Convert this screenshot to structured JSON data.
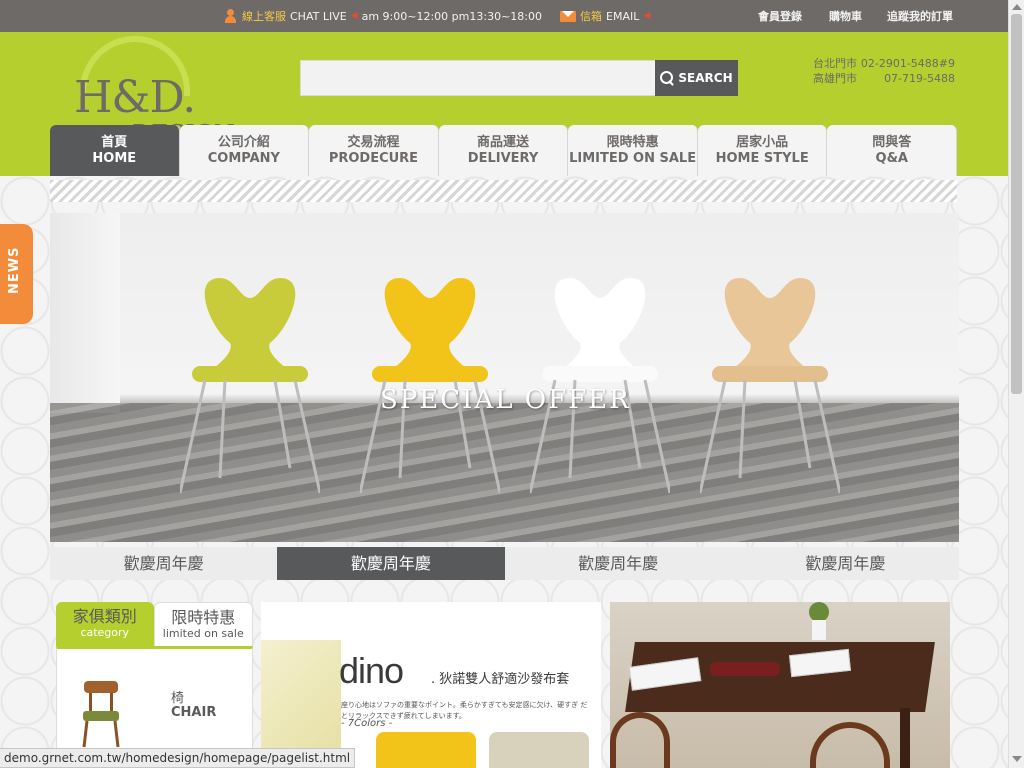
{
  "topbar": {
    "service_label": "線上客服",
    "chat_live": "CHAT LIVE",
    "hours": "am 9:00~12:00 pm13:30~18:00",
    "mail_label": "信箱",
    "mail_en": "EMAIL",
    "links": [
      "會員登錄",
      "購物車",
      "追蹤我的訂單"
    ]
  },
  "logo": {
    "main": "H&D.",
    "sub": "DESIGN"
  },
  "search": {
    "placeholder": "",
    "button_label": "SEARCH"
  },
  "stores": [
    {
      "city": "台北門市",
      "phone": "02-2901-5488#9"
    },
    {
      "city": "高雄門市",
      "phone": "07-719-5488"
    }
  ],
  "nav": [
    {
      "zh": "首頁",
      "en": "HOME",
      "active": true
    },
    {
      "zh": "公司介紹",
      "en": "COMPANY"
    },
    {
      "zh": "交易流程",
      "en": "PRODECURE"
    },
    {
      "zh": "商品運送",
      "en": "DELIVERY"
    },
    {
      "zh": "限時特惠",
      "en": "LIMITED ON SALE"
    },
    {
      "zh": "居家小品",
      "en": "HOME STYLE"
    },
    {
      "zh": "問與答",
      "en": "Q&A"
    }
  ],
  "news_tag": "NEWS",
  "banner": {
    "caption": "SPECIAL OFFER",
    "chair_colors": [
      "#c9cc3a",
      "#f2c318",
      "#ffffff",
      "#e8c697"
    ],
    "tabs": [
      "歡慶周年慶",
      "歡慶周年慶",
      "歡慶周年慶",
      "歡慶周年慶"
    ],
    "active_tab": 1
  },
  "category": {
    "tabs": [
      {
        "zh": "家俱類別",
        "en": "category",
        "active": true
      },
      {
        "zh": "限時特惠",
        "en": "limited on sale"
      }
    ],
    "items": [
      {
        "zh": "椅",
        "en": "CHAIR"
      }
    ]
  },
  "promo_dino": {
    "word": "dino",
    "title": ". 狄諾雙人舒適沙發布套",
    "desc": "座り心地はソファの重要なポイント。柔らかすぎても安定感に欠け、硬すぎ だとリラックスできず疲れてしまいます。",
    "colors": "- 7Colors -"
  },
  "statusbar_url": "demo.grnet.com.tw/homedesign/homepage/pagelist.html",
  "colors": {
    "brand_green": "#b5cf2e",
    "dark_gray": "#58595b",
    "accent_orange": "#f28c3a"
  }
}
